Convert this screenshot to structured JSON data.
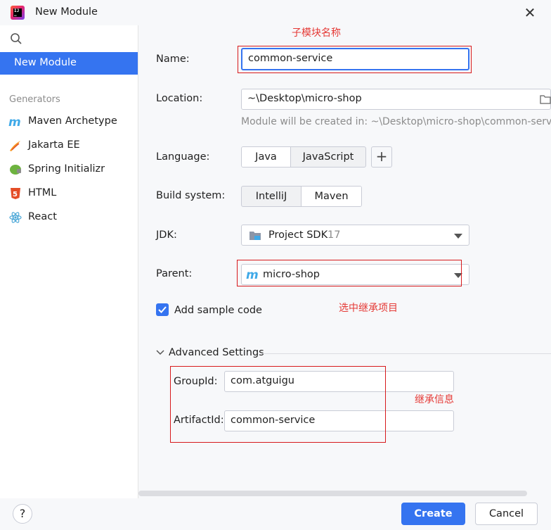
{
  "window": {
    "title": "New Module"
  },
  "sidebar": {
    "selected": "New Module",
    "group_label": "Generators",
    "items": [
      {
        "label": "Maven Archetype",
        "icon": "maven-icon"
      },
      {
        "label": "Jakarta EE",
        "icon": "jakarta-icon"
      },
      {
        "label": "Spring Initializr",
        "icon": "spring-icon"
      },
      {
        "label": "HTML",
        "icon": "html5-icon"
      },
      {
        "label": "React",
        "icon": "react-icon"
      }
    ]
  },
  "form": {
    "name_label": "Name:",
    "name_value": "common-service",
    "location_label": "Location:",
    "location_value": "~\\Desktop\\micro-shop",
    "location_hint": "Module will be created in: ~\\Desktop\\micro-shop\\common-service",
    "language_label": "Language:",
    "language_options": [
      "Java",
      "JavaScript"
    ],
    "language_selected": "Java",
    "build_label": "Build system:",
    "build_options": [
      "IntelliJ",
      "Maven"
    ],
    "build_selected": "Maven",
    "jdk_label": "JDK:",
    "jdk_value": "Project SDK",
    "jdk_version": "17",
    "parent_label": "Parent:",
    "parent_value": "micro-shop",
    "sample_code_label": "Add sample code",
    "sample_code_checked": true,
    "advanced_label": "Advanced Settings",
    "groupid_label": "GroupId:",
    "groupid_value": "com.atguigu",
    "artifactid_label": "ArtifactId:",
    "artifactid_value": "common-service"
  },
  "annotations": {
    "name_note": "子模块名称",
    "parent_note": "选中继承项目",
    "inherit_note": "继承信息"
  },
  "footer": {
    "help_label": "?",
    "create_label": "Create",
    "cancel_label": "Cancel"
  },
  "colors": {
    "accent": "#3574f0",
    "annotation": "#e53935"
  }
}
